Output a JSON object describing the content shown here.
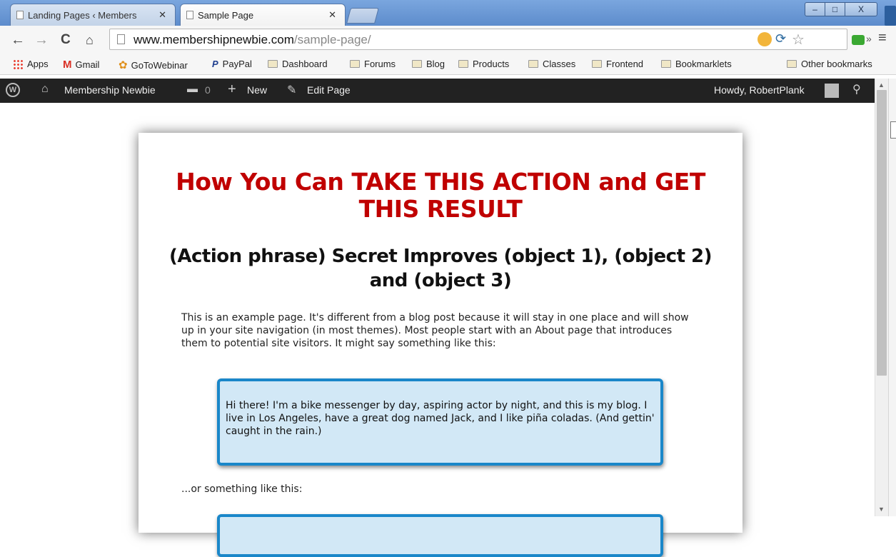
{
  "browser": {
    "tabs": [
      {
        "title": "Landing Pages ‹ Members"
      },
      {
        "title": "Sample Page"
      }
    ],
    "url": {
      "host": "www.membershipnewbie.com",
      "path": "/sample-page/"
    },
    "bookmarks": [
      "Apps",
      "Gmail",
      "GoToWebinar",
      "PayPal",
      "Dashboard",
      "Forums",
      "Blog",
      "Products",
      "Classes",
      "Frontend",
      "Bookmarklets"
    ],
    "other_bookmarks": "Other bookmarks",
    "window_controls": {
      "minimize": "–",
      "maximize": "□",
      "close": "X"
    }
  },
  "wp_admin_bar": {
    "site_name": "Membership Newbie",
    "comment_count": "0",
    "new_label": "New",
    "edit_label": "Edit Page",
    "howdy": "Howdy, RobertPlank"
  },
  "page": {
    "headline": "How You Can TAKE THIS ACTION and GET THIS RESULT",
    "subheadline": "(Action phrase) Secret Improves (object 1), (object 2) and (object 3)",
    "intro": "This is an example page. It's different from a blog post because it will stay in one place and will show up in your site navigation (in most themes). Most people start with an About page that introduces them to potential site visitors. It might say something like this:",
    "quote1": "Hi there! I'm a bike messenger by day, aspiring actor by night, and this is my blog. I live in Los Angeles, have a great dog named Jack, and I like piña coladas. (And gettin' caught in the rain.)",
    "transition": "...or something like this:"
  },
  "colors": {
    "headline": "#c00000",
    "quote_border": "#1a87c9",
    "quote_bg": "#d2e8f6",
    "admin_bar": "#222222"
  },
  "icons": [
    "page-icon",
    "back-icon",
    "forward-icon",
    "reload-icon",
    "home-icon",
    "star-icon",
    "menu-icon",
    "folder-icon",
    "wordpress-logo-icon",
    "comment-icon",
    "plus-icon",
    "pencil-icon",
    "search-icon"
  ]
}
